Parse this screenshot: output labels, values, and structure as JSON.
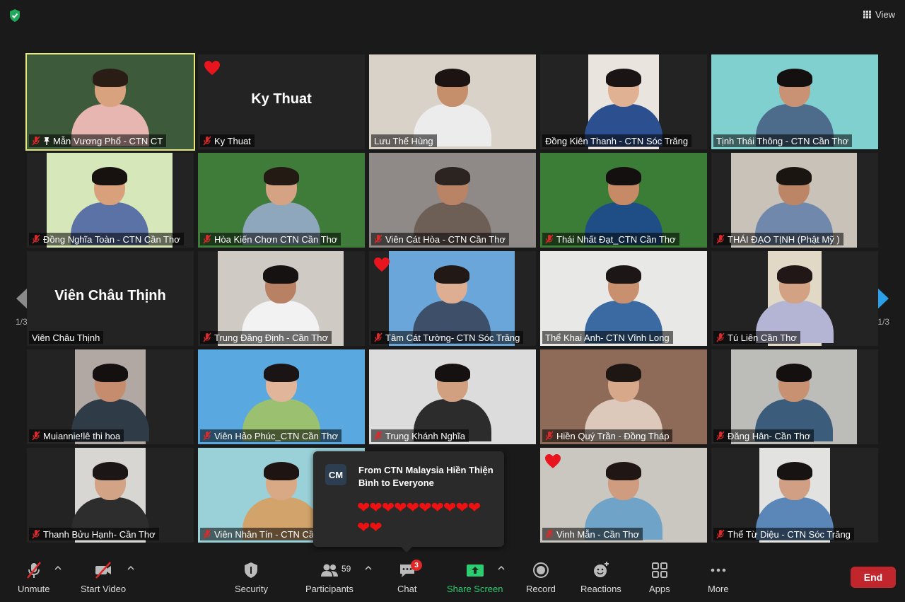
{
  "header": {
    "view_label": "View",
    "security_status_icon": "shield-check-icon"
  },
  "pagination": {
    "left": "1/3",
    "right": "1/3"
  },
  "tiles": [
    {
      "name": "Mẫn Vương Phổ - CTN CT",
      "muted": true,
      "pinned": true,
      "active": true,
      "wall": "#3d5a3a",
      "skin": "#d9a27f",
      "shirt": "#e7b6b0",
      "hair": "#2a1d16"
    },
    {
      "name": "Ky Thuat",
      "muted": true,
      "big_name": "Ky Thuat",
      "reaction": "heart"
    },
    {
      "name": "Lưu Thế Hùng",
      "muted": false,
      "wall": "#d9d2c8",
      "skin": "#c58f6c",
      "shirt": "#ececec",
      "hair": "#1b1412"
    },
    {
      "name": "Đồng Kiên Thanh - CTN Sóc Trăng",
      "muted": false,
      "wall": "#e9e4dd",
      "skin": "#e0b293",
      "shirt": "#2c4f8f",
      "hair": "#1a1414"
    },
    {
      "name": "Tịnh Thái Thông - CTN Cần Thơ",
      "muted": false,
      "wall": "#7fd0cf",
      "skin": "#c99274",
      "shirt": "#4d6c8b",
      "hair": "#151010"
    },
    {
      "name": "Đồng Nghĩa Toàn - CTN Cần Thơ",
      "muted": true,
      "wall": "#d6e7ba",
      "skin": "#d9a07c",
      "shirt": "#5a72a6",
      "hair": "#17120f"
    },
    {
      "name": "Hòa Kiến Chơn CTN Cần Thơ",
      "muted": true,
      "wall": "#3f7c3a",
      "skin": "#d5a384",
      "shirt": "#8fa7bd",
      "hair": "#241a14"
    },
    {
      "name": "Viên Cát Hòa - CTN Cần Thơ",
      "muted": true,
      "wall": "#8f8a88",
      "skin": "#b98366",
      "shirt": "#6d5e56",
      "hair": "#2b2420"
    },
    {
      "name": "Thái Nhất Đạt_CTN Cần Thơ",
      "muted": true,
      "wall": "#3b7d36",
      "skin": "#c68a66",
      "shirt": "#1f4e86",
      "hair": "#151010"
    },
    {
      "name": "THÁI ĐẠO TỊNH (Phật Mỹ )",
      "muted": true,
      "wall": "#c8c2b8",
      "skin": "#bc8566",
      "shirt": "#6f88ac",
      "hair": "#1b1512"
    },
    {
      "name": "Viên Châu Thịnh",
      "muted": false,
      "big_name": "Viên Châu Thịnh"
    },
    {
      "name": "Trung Đăng Định - Cần Thơ",
      "muted": true,
      "wall": "#cfcbc4",
      "skin": "#b98163",
      "shirt": "#f2f2f2",
      "hair": "#171212"
    },
    {
      "name": "Tâm Cát Tường- CTN Sóc Trăng",
      "muted": true,
      "reaction": "heart",
      "wall": "#6aa6d9",
      "skin": "#deae93",
      "shirt": "#3e4f6a",
      "hair": "#221816"
    },
    {
      "name": "Thể Khai Anh- CTN Vĩnh Long",
      "muted": false,
      "wall": "#e8e8e6",
      "skin": "#c8906f",
      "shirt": "#3b6aa3",
      "hair": "#1c1616"
    },
    {
      "name": "Tú Liên Cần Thơ",
      "muted": true,
      "wall": "#e2d8c6",
      "skin": "#d3a184",
      "shirt": "#b4b4d4",
      "hair": "#211717"
    },
    {
      "name": "Muiannie!lê thi hoa",
      "muted": true,
      "wall": "#b1a8a3",
      "skin": "#c58d6e",
      "shirt": "#2f3b47",
      "hair": "#141010"
    },
    {
      "name": "Viên Hảo Phúc_CTN Cần Thơ",
      "muted": true,
      "wall": "#59a8e0",
      "skin": "#e0b59a",
      "shirt": "#9bc070",
      "hair": "#1b1414"
    },
    {
      "name": "Trung Khánh Nghĩa",
      "muted": true,
      "wall": "#dcdcdc",
      "skin": "#d1a081",
      "shirt": "#2c2c2c",
      "hair": "#151111"
    },
    {
      "name": "Hiền Quý Trần - Đồng Tháp",
      "muted": true,
      "wall": "#8e6b58",
      "skin": "#d8a88b",
      "shirt": "#dcc9bb",
      "hair": "#1e1613"
    },
    {
      "name": "Đăng Hân- Cần Thơ",
      "muted": true,
      "wall": "#bcbcb8",
      "skin": "#c79172",
      "shirt": "#3b5c7a",
      "hair": "#141010"
    },
    {
      "name": "Thanh Bửu Hạnh- Cần Thơ",
      "muted": true,
      "wall": "#d8d6d2",
      "skin": "#d3a385",
      "shirt": "#2d2d2d",
      "hair": "#1c1616"
    },
    {
      "name": "Viên Nhân Tín - CTN Cầ",
      "muted": true,
      "wall": "#9ad0d8",
      "skin": "#d9a986",
      "shirt": "#d2a36a",
      "hair": "#1e1512"
    },
    {
      "name": "",
      "muted": false,
      "hidden": true
    },
    {
      "name": "Vinh Mẫn - Cần Thơ",
      "muted": true,
      "reaction": "heart",
      "wall": "#c9c7bf",
      "skin": "#cf9c7f",
      "shirt": "#6fa3c7",
      "hair": "#201715"
    },
    {
      "name": "Thể Từ Diệu - CTN Sóc Trăng",
      "muted": true,
      "wall": "#e2e2e0",
      "skin": "#d1a084",
      "shirt": "#5a86b8",
      "hair": "#171313"
    }
  ],
  "chat_popup": {
    "avatar_initials": "CM",
    "from": "From CTN Malaysia Hiền Thiện Bình to Everyone",
    "message": "❤❤❤❤❤❤❤❤❤❤❤❤"
  },
  "toolbar": {
    "unmute": "Unmute",
    "start_video": "Start Video",
    "security": "Security",
    "participants": "Participants",
    "participants_count": "59",
    "chat": "Chat",
    "chat_badge": "3",
    "share_screen": "Share Screen",
    "record": "Record",
    "reactions": "Reactions",
    "apps": "Apps",
    "more": "More",
    "end": "End"
  },
  "colors": {
    "active_border": "#e6e67a",
    "share_green": "#2ecc71",
    "end_red": "#c0262b",
    "mute_red": "#e02828"
  }
}
